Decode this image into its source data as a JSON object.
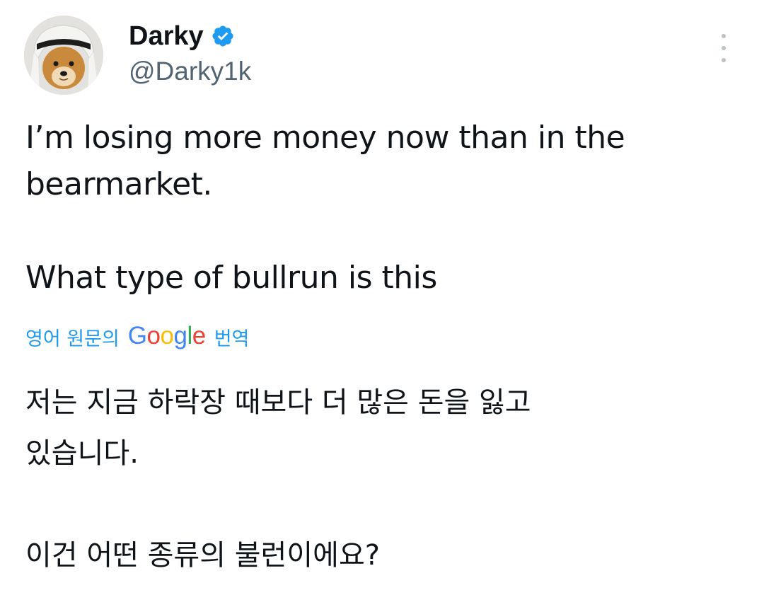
{
  "user": {
    "display_name": "Darky",
    "handle": "@Darky1k",
    "verified": true,
    "avatar_description": "dog-avatar"
  },
  "tweet": {
    "lines": [
      "I’m losing more money now than in the",
      "bearmarket.",
      "What type of bullrun is this"
    ]
  },
  "translation": {
    "label_prefix": "영어 원문의",
    "brand": "Google",
    "label_suffix": "번역",
    "lines": [
      "저는 지금 하락장 때보다 더 많은 돈을 잃고",
      "있습니다.",
      "이건 어떤 종류의 불런이에요?"
    ]
  },
  "colors": {
    "text": "#0f1419",
    "secondary": "#536471",
    "accent": "#1d9bf0",
    "google_blue": "#4285F4",
    "google_red": "#EA4335",
    "google_yellow": "#FBBC05",
    "google_green": "#34A853"
  },
  "icons": {
    "verified": "verified-badge-icon",
    "more": "more-vertical-icon"
  }
}
